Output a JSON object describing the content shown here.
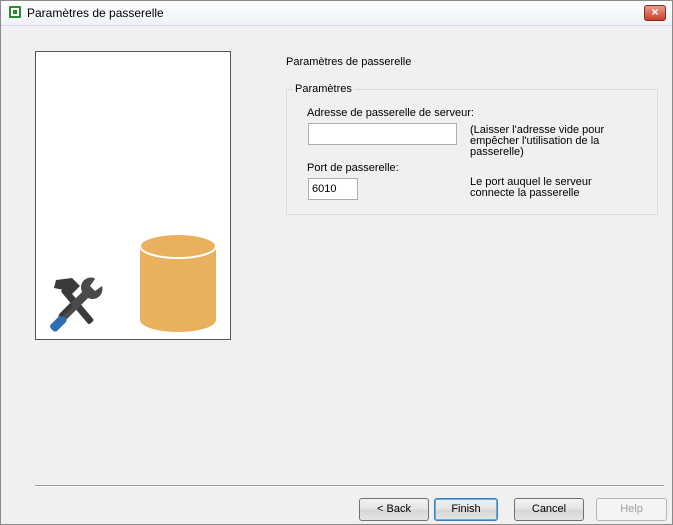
{
  "window": {
    "title": "Paramètres de passerelle",
    "close_label": "×"
  },
  "page": {
    "title": "Paramètres de passerelle"
  },
  "group": {
    "legend": "Paramètres",
    "server_address": {
      "label": "Adresse de passerelle de serveur:",
      "value": "",
      "hint_lines": [
        "(Laisser l'adresse vide pour",
        "empêcher l'utilisation de la",
        "passerelle)"
      ]
    },
    "port": {
      "label": "Port de passerelle:",
      "value": "6010",
      "hint_lines": [
        "Le port auquel le serveur",
        "connecte la passerelle"
      ]
    }
  },
  "buttons": {
    "back": "< Back",
    "finish": "Finish",
    "cancel": "Cancel",
    "help": "Help"
  },
  "colors": {
    "database": "#e9b15e",
    "tool_blue": "#2e6db4",
    "tool_gray": "#3a3a3a"
  },
  "icons": {
    "illustration": [
      "tools-icon",
      "database-icon"
    ]
  }
}
